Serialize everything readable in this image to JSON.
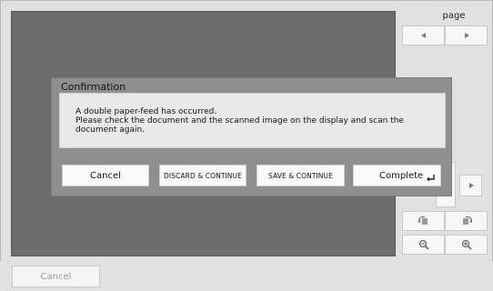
{
  "right_panel": {
    "page_label": "page",
    "prev_icon": "triangle-left-icon",
    "next_icon": "triangle-right-icon",
    "rotate_left_icon": "rotate-left-icon",
    "rotate_right_icon": "rotate-right-icon",
    "zoom_out_icon": "zoom-out-icon",
    "zoom_in_icon": "zoom-in-icon"
  },
  "dialog": {
    "title": "Confirmation",
    "message_line1": "A double paper-feed has occurred.",
    "message_line2": "Please check the document and the scanned image on the display and scan the document again.",
    "buttons": {
      "cancel": "Cancel",
      "discard_continue": "DISCARD & CONTINUE",
      "save_continue": "SAVE & CONTINUE",
      "complete": "Complete"
    },
    "complete_icon": "enter-key-icon"
  },
  "bottom": {
    "cancel_label": "Cancel"
  },
  "colors": {
    "viewer_bg": "#6d6d6d",
    "dialog_frame": "#8f8f8f",
    "dialog_body": "#e9e9e9",
    "background": "#e1e1e1"
  }
}
